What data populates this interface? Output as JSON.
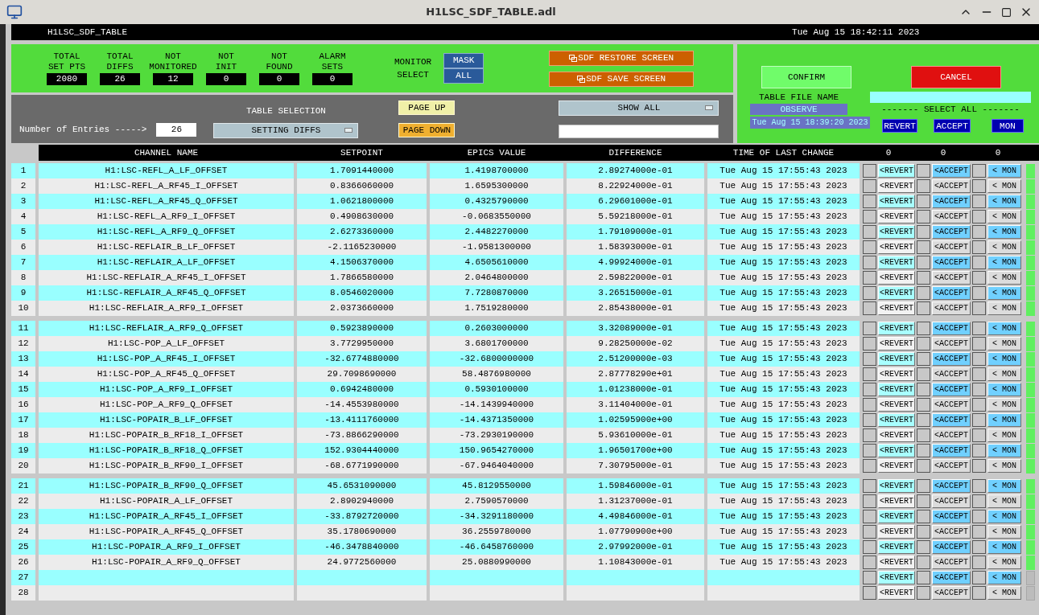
{
  "window": {
    "title": "H1LSC_SDF_TABLE.adl"
  },
  "header": {
    "name": "H1LSC_SDF_TABLE",
    "time": "Tue Aug 15 18:42:11 2023"
  },
  "stats": [
    {
      "label": [
        "TOTAL",
        "SET PTS"
      ],
      "value": "2080"
    },
    {
      "label": [
        "TOTAL",
        "DIFFS"
      ],
      "value": "26"
    },
    {
      "label": [
        "NOT",
        "MONITORED"
      ],
      "value": "12"
    },
    {
      "label": [
        "NOT",
        "INIT"
      ],
      "value": "0"
    },
    {
      "label": [
        "NOT",
        "FOUND"
      ],
      "value": "0"
    },
    {
      "label": [
        "ALARM",
        "SETS"
      ],
      "value": "0"
    }
  ],
  "monitor_select": {
    "label": [
      "MONITOR",
      "SELECT"
    ],
    "options": [
      "MASK",
      "ALL"
    ]
  },
  "screen_buttons": [
    "SDF RESTORE SCREEN",
    "SDF SAVE SCREEN"
  ],
  "entries": {
    "label": "Number of Entries ----->",
    "value": "26"
  },
  "table_selection": {
    "label": "TABLE SELECTION",
    "value": "SETTING DIFFS"
  },
  "paging": [
    {
      "label": "PAGE UP",
      "kind": "up"
    },
    {
      "label": "PAGE DOWN",
      "kind": "down"
    }
  ],
  "filter": {
    "value": "SHOW ALL"
  },
  "confirm_panel": {
    "confirm": "CONFIRM",
    "cancel": "CANCEL",
    "file_label": "TABLE FILE NAME",
    "file_name": "OBSERVE",
    "file_time": "Tue Aug 15 18:39:20 2023",
    "select_all_label": "------- SELECT ALL -------",
    "select_all": [
      "REVERT",
      "ACCEPT",
      "MON"
    ]
  },
  "table": {
    "columns": [
      "CHANNEL NAME",
      "SETPOINT",
      "EPICS VALUE",
      "DIFFERENCE",
      "TIME OF LAST CHANGE"
    ],
    "counts": [
      "0",
      "0",
      "0"
    ],
    "groups": [
      {
        "rows": [
          {
            "number": "1",
            "channel": "H1:LSC-REFL_A_LF_OFFSET",
            "setpoint": "1.7091440000",
            "epics": "1.4198700000",
            "difference": "2.89274000e-01",
            "time": "Tue Aug 15 17:55:43 2023",
            "checks": [
              false,
              false,
              false
            ],
            "actions": [
              "<REVERT",
              "<ACCEPT",
              "< MON"
            ],
            "indicator": true
          },
          {
            "number": "2",
            "channel": "H1:LSC-REFL_A_RF45_I_OFFSET",
            "setpoint": "0.8366060000",
            "epics": "1.6595300000",
            "difference": "8.22924000e-01",
            "time": "Tue Aug 15 17:55:43 2023",
            "checks": [
              false,
              false,
              false
            ],
            "actions": [
              "<REVERT",
              "<ACCEPT",
              "< MON"
            ],
            "indicator": true
          },
          {
            "number": "3",
            "channel": "H1:LSC-REFL_A_RF45_Q_OFFSET",
            "setpoint": "1.0621800000",
            "epics": "0.4325790000",
            "difference": "6.29601000e-01",
            "time": "Tue Aug 15 17:55:43 2023",
            "checks": [
              false,
              false,
              false
            ],
            "actions": [
              "<REVERT",
              "<ACCEPT",
              "< MON"
            ],
            "indicator": true
          },
          {
            "number": "4",
            "channel": "H1:LSC-REFL_A_RF9_I_OFFSET",
            "setpoint": "0.4908630000",
            "epics": "-0.0683550000",
            "difference": "5.59218000e-01",
            "time": "Tue Aug 15 17:55:43 2023",
            "checks": [
              false,
              false,
              false
            ],
            "actions": [
              "<REVERT",
              "<ACCEPT",
              "< MON"
            ],
            "indicator": true
          },
          {
            "number": "5",
            "channel": "H1:LSC-REFL_A_RF9_Q_OFFSET",
            "setpoint": "2.6273360000",
            "epics": "2.4482270000",
            "difference": "1.79109000e-01",
            "time": "Tue Aug 15 17:55:43 2023",
            "checks": [
              false,
              false,
              false
            ],
            "actions": [
              "<REVERT",
              "<ACCEPT",
              "< MON"
            ],
            "indicator": true
          },
          {
            "number": "6",
            "channel": "H1:LSC-REFLAIR_B_LF_OFFSET",
            "setpoint": "-2.1165230000",
            "epics": "-1.9581300000",
            "difference": "1.58393000e-01",
            "time": "Tue Aug 15 17:55:43 2023",
            "checks": [
              false,
              false,
              false
            ],
            "actions": [
              "<REVERT",
              "<ACCEPT",
              "< MON"
            ],
            "indicator": true
          },
          {
            "number": "7",
            "channel": "H1:LSC-REFLAIR_A_LF_OFFSET",
            "setpoint": "4.1506370000",
            "epics": "4.6505610000",
            "difference": "4.99924000e-01",
            "time": "Tue Aug 15 17:55:43 2023",
            "checks": [
              false,
              false,
              false
            ],
            "actions": [
              "<REVERT",
              "<ACCEPT",
              "< MON"
            ],
            "indicator": true
          },
          {
            "number": "8",
            "channel": "H1:LSC-REFLAIR_A_RF45_I_OFFSET",
            "setpoint": "1.7866580000",
            "epics": "2.0464800000",
            "difference": "2.59822000e-01",
            "time": "Tue Aug 15 17:55:43 2023",
            "checks": [
              false,
              false,
              false
            ],
            "actions": [
              "<REVERT",
              "<ACCEPT",
              "< MON"
            ],
            "indicator": true
          },
          {
            "number": "9",
            "channel": "H1:LSC-REFLAIR_A_RF45_Q_OFFSET",
            "setpoint": "8.0546020000",
            "epics": "7.7280870000",
            "difference": "3.26515000e-01",
            "time": "Tue Aug 15 17:55:43 2023",
            "checks": [
              false,
              false,
              false
            ],
            "actions": [
              "<REVERT",
              "<ACCEPT",
              "< MON"
            ],
            "indicator": true
          },
          {
            "number": "10",
            "channel": "H1:LSC-REFLAIR_A_RF9_I_OFFSET",
            "setpoint": "2.0373660000",
            "epics": "1.7519280000",
            "difference": "2.85438000e-01",
            "time": "Tue Aug 15 17:55:43 2023",
            "checks": [
              false,
              false,
              false
            ],
            "actions": [
              "<REVERT",
              "<ACCEPT",
              "< MON"
            ],
            "indicator": true
          }
        ]
      },
      {
        "rows": [
          {
            "number": "11",
            "channel": "H1:LSC-REFLAIR_A_RF9_Q_OFFSET",
            "setpoint": "0.5923890000",
            "epics": "0.2603000000",
            "difference": "3.32089000e-01",
            "time": "Tue Aug 15 17:55:43 2023",
            "checks": [
              false,
              false,
              false
            ],
            "actions": [
              "<REVERT",
              "<ACCEPT",
              "< MON"
            ],
            "indicator": true
          },
          {
            "number": "12",
            "channel": "H1:LSC-POP_A_LF_OFFSET",
            "setpoint": "3.7729950000",
            "epics": "3.6801700000",
            "difference": "9.28250000e-02",
            "time": "Tue Aug 15 17:55:43 2023",
            "checks": [
              false,
              false,
              false
            ],
            "actions": [
              "<REVERT",
              "<ACCEPT",
              "< MON"
            ],
            "indicator": true
          },
          {
            "number": "13",
            "channel": "H1:LSC-POP_A_RF45_I_OFFSET",
            "setpoint": "-32.6774880000",
            "epics": "-32.6800000000",
            "difference": "2.51200000e-03",
            "time": "Tue Aug 15 17:55:43 2023",
            "checks": [
              false,
              false,
              false
            ],
            "actions": [
              "<REVERT",
              "<ACCEPT",
              "< MON"
            ],
            "indicator": true
          },
          {
            "number": "14",
            "channel": "H1:LSC-POP_A_RF45_Q_OFFSET",
            "setpoint": "29.7098690000",
            "epics": "58.4876980000",
            "difference": "2.87778290e+01",
            "time": "Tue Aug 15 17:55:43 2023",
            "checks": [
              false,
              false,
              false
            ],
            "actions": [
              "<REVERT",
              "<ACCEPT",
              "< MON"
            ],
            "indicator": true
          },
          {
            "number": "15",
            "channel": "H1:LSC-POP_A_RF9_I_OFFSET",
            "setpoint": "0.6942480000",
            "epics": "0.5930100000",
            "difference": "1.01238000e-01",
            "time": "Tue Aug 15 17:55:43 2023",
            "checks": [
              false,
              false,
              false
            ],
            "actions": [
              "<REVERT",
              "<ACCEPT",
              "< MON"
            ],
            "indicator": true
          },
          {
            "number": "16",
            "channel": "H1:LSC-POP_A_RF9_Q_OFFSET",
            "setpoint": "-14.4553980000",
            "epics": "-14.1439940000",
            "difference": "3.11404000e-01",
            "time": "Tue Aug 15 17:55:43 2023",
            "checks": [
              false,
              false,
              false
            ],
            "actions": [
              "<REVERT",
              "<ACCEPT",
              "< MON"
            ],
            "indicator": true
          },
          {
            "number": "17",
            "channel": "H1:LSC-POPAIR_B_LF_OFFSET",
            "setpoint": "-13.4111760000",
            "epics": "-14.4371350000",
            "difference": "1.02595900e+00",
            "time": "Tue Aug 15 17:55:43 2023",
            "checks": [
              false,
              false,
              false
            ],
            "actions": [
              "<REVERT",
              "<ACCEPT",
              "< MON"
            ],
            "indicator": true
          },
          {
            "number": "18",
            "channel": "H1:LSC-POPAIR_B_RF18_I_OFFSET",
            "setpoint": "-73.8866290000",
            "epics": "-73.2930190000",
            "difference": "5.93610000e-01",
            "time": "Tue Aug 15 17:55:43 2023",
            "checks": [
              false,
              false,
              false
            ],
            "actions": [
              "<REVERT",
              "<ACCEPT",
              "< MON"
            ],
            "indicator": true
          },
          {
            "number": "19",
            "channel": "H1:LSC-POPAIR_B_RF18_Q_OFFSET",
            "setpoint": "152.9304440000",
            "epics": "150.9654270000",
            "difference": "1.96501700e+00",
            "time": "Tue Aug 15 17:55:43 2023",
            "checks": [
              false,
              false,
              false
            ],
            "actions": [
              "<REVERT",
              "<ACCEPT",
              "< MON"
            ],
            "indicator": true
          },
          {
            "number": "20",
            "channel": "H1:LSC-POPAIR_B_RF90_I_OFFSET",
            "setpoint": "-68.6771990000",
            "epics": "-67.9464040000",
            "difference": "7.30795000e-01",
            "time": "Tue Aug 15 17:55:43 2023",
            "checks": [
              false,
              false,
              false
            ],
            "actions": [
              "<REVERT",
              "<ACCEPT",
              "< MON"
            ],
            "indicator": true
          }
        ]
      },
      {
        "rows": [
          {
            "number": "21",
            "channel": "H1:LSC-POPAIR_B_RF90_Q_OFFSET",
            "setpoint": "45.6531090000",
            "epics": "45.8129550000",
            "difference": "1.59846000e-01",
            "time": "Tue Aug 15 17:55:43 2023",
            "checks": [
              false,
              false,
              false
            ],
            "actions": [
              "<REVERT",
              "<ACCEPT",
              "< MON"
            ],
            "indicator": true
          },
          {
            "number": "22",
            "channel": "H1:LSC-POPAIR_A_LF_OFFSET",
            "setpoint": "2.8902940000",
            "epics": "2.7590570000",
            "difference": "1.31237000e-01",
            "time": "Tue Aug 15 17:55:43 2023",
            "checks": [
              false,
              false,
              false
            ],
            "actions": [
              "<REVERT",
              "<ACCEPT",
              "< MON"
            ],
            "indicator": true
          },
          {
            "number": "23",
            "channel": "H1:LSC-POPAIR_A_RF45_I_OFFSET",
            "setpoint": "-33.8792720000",
            "epics": "-34.3291180000",
            "difference": "4.49846000e-01",
            "time": "Tue Aug 15 17:55:43 2023",
            "checks": [
              false,
              false,
              false
            ],
            "actions": [
              "<REVERT",
              "<ACCEPT",
              "< MON"
            ],
            "indicator": true
          },
          {
            "number": "24",
            "channel": "H1:LSC-POPAIR_A_RF45_Q_OFFSET",
            "setpoint": "35.1780690000",
            "epics": "36.2559780000",
            "difference": "1.07790900e+00",
            "time": "Tue Aug 15 17:55:43 2023",
            "checks": [
              false,
              false,
              false
            ],
            "actions": [
              "<REVERT",
              "<ACCEPT",
              "< MON"
            ],
            "indicator": true
          },
          {
            "number": "25",
            "channel": "H1:LSC-POPAIR_A_RF9_I_OFFSET",
            "setpoint": "-46.3478840000",
            "epics": "-46.6458760000",
            "difference": "2.97992000e-01",
            "time": "Tue Aug 15 17:55:43 2023",
            "checks": [
              false,
              false,
              false
            ],
            "actions": [
              "<REVERT",
              "<ACCEPT",
              "< MON"
            ],
            "indicator": true
          },
          {
            "number": "26",
            "channel": "H1:LSC-POPAIR_A_RF9_Q_OFFSET",
            "setpoint": "24.9772560000",
            "epics": "25.0880990000",
            "difference": "1.10843000e-01",
            "time": "Tue Aug 15 17:55:43 2023",
            "checks": [
              false,
              false,
              false
            ],
            "actions": [
              "<REVERT",
              "<ACCEPT",
              "< MON"
            ],
            "indicator": true
          },
          {
            "number": "27",
            "checks": [
              false,
              false,
              false
            ],
            "actions": [
              "<REVERT",
              "<ACCEPT",
              "< MON"
            ],
            "indicator": false
          },
          {
            "number": "28",
            "checks": [
              false,
              false,
              false
            ],
            "actions": [
              "<REVERT",
              "<ACCEPT",
              "< MON"
            ],
            "indicator": false
          }
        ]
      }
    ]
  }
}
